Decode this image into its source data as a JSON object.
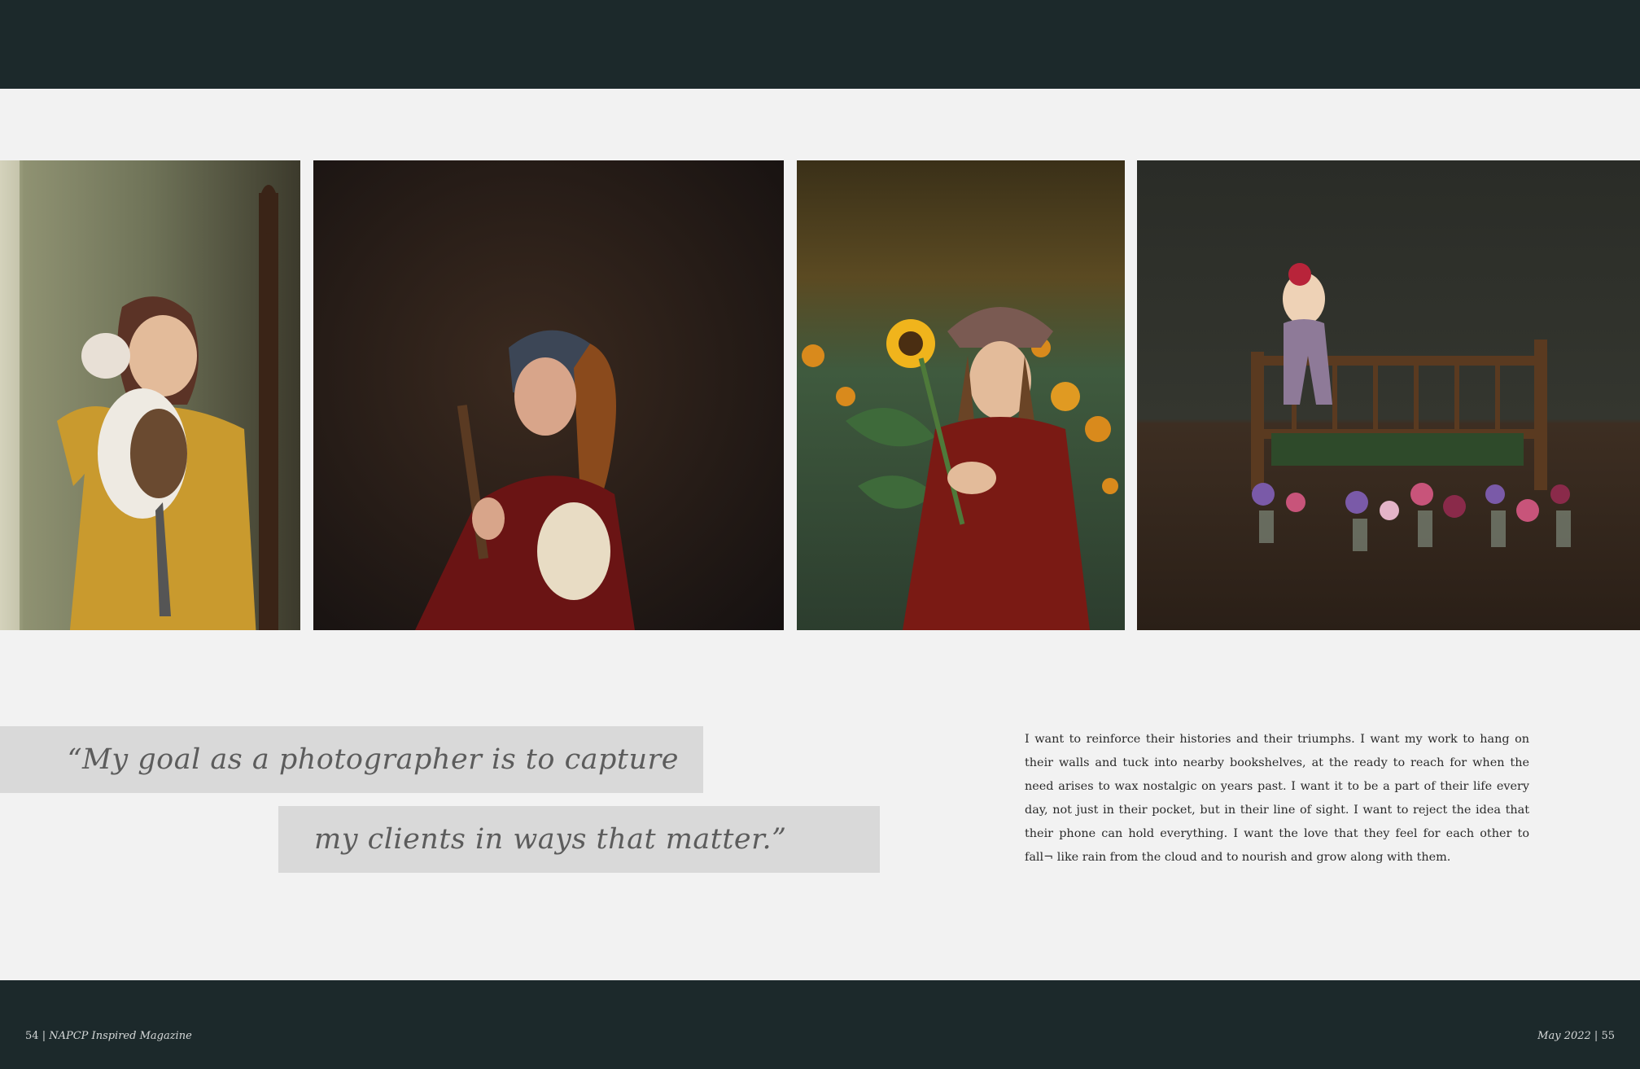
{
  "photos": [
    {
      "name": "girl-holding-cat"
    },
    {
      "name": "girl-pearl-earring-costume"
    },
    {
      "name": "girl-with-sunflower"
    },
    {
      "name": "baby-in-crib-with-flowers"
    }
  ],
  "quote": {
    "line1": "“My goal as a photographer is to capture",
    "line2": "my clients in ways that matter.”"
  },
  "body_text": "I want to reinforce their histories and their triumphs. I want my work to hang on their walls and tuck into nearby bookshelves, at the ready to reach for when the need arises to wax nostalgic on years past. I want it to be a part of their life every day, not just in their pocket, but in their line of sight. I want to reject the idea that their phone can hold everything. I want the love that they feel for each other to fall¬ like rain from the cloud and to nourish and grow along with them.",
  "footer": {
    "left_page_number": "54",
    "left_separator": "|",
    "left_magazine": "NAPCP Inspired Magazine",
    "right_issue": "May 2022",
    "right_separator": "|",
    "right_page_number": "55"
  },
  "colors": {
    "band": "#1c292b",
    "page": "#f2f2f2",
    "quote_box": "#d9d9d9"
  }
}
